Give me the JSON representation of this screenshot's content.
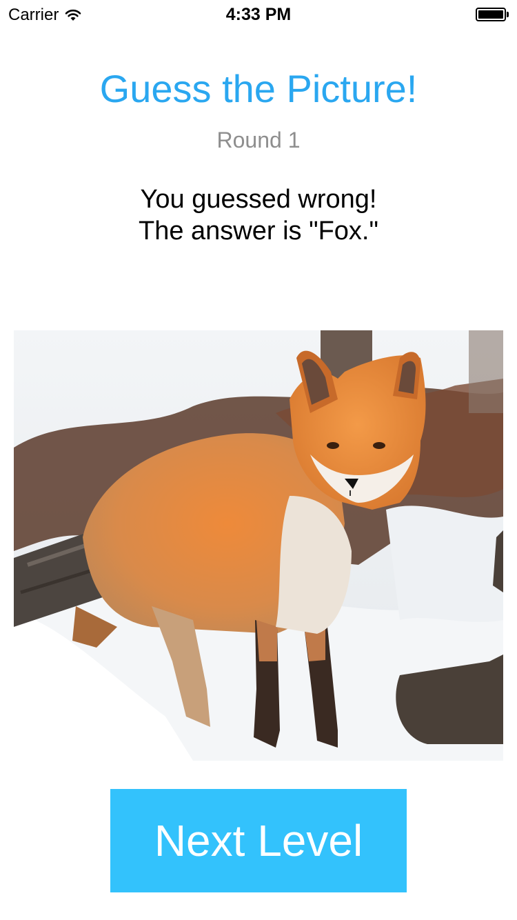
{
  "status_bar": {
    "carrier": "Carrier",
    "time": "4:33 PM",
    "wifi_icon": "wifi-icon",
    "battery_icon": "battery-full-icon",
    "battery_level": 1.0
  },
  "header": {
    "title": "Guess the Picture!",
    "round": "Round 1"
  },
  "result": {
    "line1": "You guessed wrong!",
    "line2": "The answer is \"Fox.\""
  },
  "picture": {
    "subject": "fox"
  },
  "actions": {
    "next_label": "Next Level"
  },
  "colors": {
    "title": "#2aa7f0",
    "round": "#8e8e8e",
    "button": "#33c2fc"
  }
}
